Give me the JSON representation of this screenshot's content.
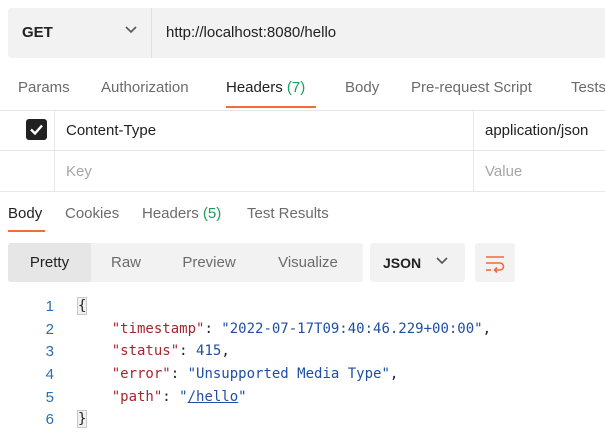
{
  "request": {
    "method": "GET",
    "url": "http://localhost:8080/hello"
  },
  "request_tabs": {
    "params": "Params",
    "authorization": "Authorization",
    "headers": "Headers",
    "headers_count": "(7)",
    "body": "Body",
    "prerequest": "Pre-request Script",
    "tests": "Tests"
  },
  "headers_table": {
    "row1": {
      "key": "Content-Type",
      "value": "application/json",
      "checked": true
    },
    "row2": {
      "key_placeholder": "Key",
      "value_placeholder": "Value"
    }
  },
  "response_tabs": {
    "body": "Body",
    "cookies": "Cookies",
    "headers": "Headers",
    "headers_count": "(5)",
    "test_results": "Test Results"
  },
  "format_toolbar": {
    "pretty": "Pretty",
    "raw": "Raw",
    "preview": "Preview",
    "visualize": "Visualize",
    "language": "JSON"
  },
  "response_body": {
    "line_numbers": [
      "1",
      "2",
      "3",
      "4",
      "5",
      "6"
    ],
    "open_brace": "{",
    "close_brace": "}",
    "timestamp_key": "\"timestamp\"",
    "timestamp_value": "\"2022-07-17T09:40:46.229+00:00\"",
    "status_key": "\"status\"",
    "status_value": "415",
    "error_key": "\"error\"",
    "error_value": "\"Unsupported Media Type\"",
    "path_key": "\"path\"",
    "path_value": "/hello"
  },
  "colors": {
    "accent": "#f26b3a",
    "count_green": "#1a9e5b",
    "json_key": "#a6252e",
    "json_value": "#1f4fa3"
  }
}
